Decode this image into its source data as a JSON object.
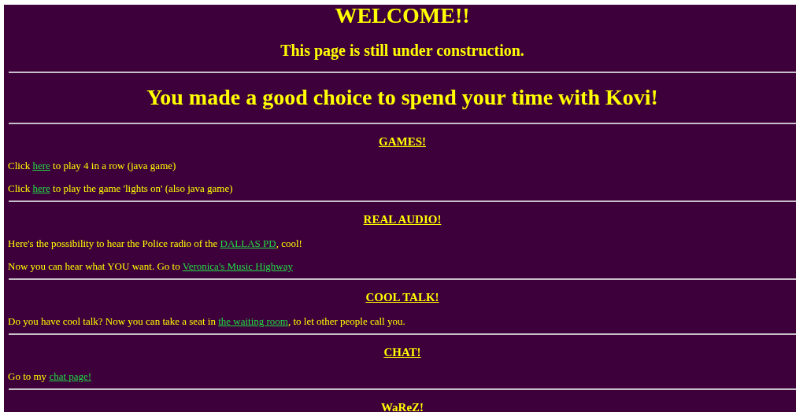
{
  "title": "WELCOME!!",
  "subtitle": "This page is still under construction.",
  "tagline": "You made a good choice to spend your time with Kovi!",
  "sections": [
    {
      "heading": "GAMES!",
      "paragraphs": [
        [
          {
            "kind": "text",
            "text": "Click "
          },
          {
            "kind": "link",
            "text": "here"
          },
          {
            "kind": "text",
            "text": " to play 4 in a row (java game)"
          }
        ],
        [
          {
            "kind": "text",
            "text": "Click "
          },
          {
            "kind": "link",
            "text": "here"
          },
          {
            "kind": "text",
            "text": " to play the game 'lights on' (also java game)"
          }
        ]
      ]
    },
    {
      "heading": "REAL AUDIO!",
      "paragraphs": [
        [
          {
            "kind": "text",
            "text": "Here's the possibility to hear the Police radio of the "
          },
          {
            "kind": "link",
            "text": "DALLAS PD"
          },
          {
            "kind": "text",
            "text": ", cool!"
          }
        ],
        [
          {
            "kind": "text",
            "text": "Now you can hear what YOU want. Go to "
          },
          {
            "kind": "link",
            "text": "Veronica's Music Highway"
          }
        ]
      ]
    },
    {
      "heading": "COOL TALK!",
      "paragraphs": [
        [
          {
            "kind": "text",
            "text": "Do you have cool talk? Now you can take a seat in "
          },
          {
            "kind": "link",
            "text": "the waiting room"
          },
          {
            "kind": "text",
            "text": ", to let other people call you."
          }
        ]
      ]
    },
    {
      "heading": "CHAT!",
      "paragraphs": [
        [
          {
            "kind": "text",
            "text": "Go to my "
          },
          {
            "kind": "link",
            "text": "chat page!"
          }
        ]
      ]
    },
    {
      "heading": "WaReZ!"
    }
  ]
}
